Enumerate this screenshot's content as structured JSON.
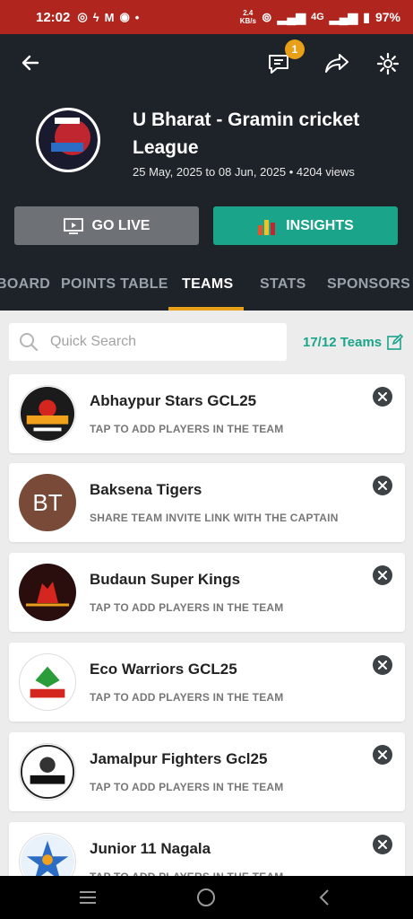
{
  "status": {
    "time": "12:02",
    "speed_top": "2.4",
    "speed_bottom": "KB/s",
    "network": "4G",
    "battery": "97%"
  },
  "header": {
    "back_icon": "back-arrow-icon",
    "message_badge": "1",
    "tournament_title": "U Bharat - Gramin cricket League",
    "dates": "25 May, 2025 to 08 Jun, 2025",
    "views": "4204 views",
    "go_live_label": "GO LIVE",
    "insights_label": "INSIGHTS"
  },
  "tabs": [
    "BOARD",
    "POINTS TABLE",
    "TEAMS",
    "STATS",
    "SPONSORS"
  ],
  "active_tab": "TEAMS",
  "search": {
    "placeholder": "Quick Search"
  },
  "teams_count": "17/12 Teams",
  "teams": [
    {
      "name": "Abhaypur Stars GCL25",
      "sub": "TAP TO ADD PLAYERS IN THE TEAM"
    },
    {
      "name": "Baksena Tigers",
      "sub": "SHARE TEAM INVITE LINK WITH THE CAPTAIN",
      "initials": "BT"
    },
    {
      "name": "Budaun Super Kings",
      "sub": "TAP TO ADD PLAYERS IN THE TEAM"
    },
    {
      "name": "Eco Warriors GCL25",
      "sub": "TAP TO ADD PLAYERS IN THE TEAM"
    },
    {
      "name": "Jamalpur Fighters Gcl25",
      "sub": "TAP TO ADD PLAYERS IN THE TEAM"
    },
    {
      "name": "Junior 11 Nagala",
      "sub": "TAP TO ADD PLAYERS IN THE TEAM"
    }
  ],
  "colors": {
    "accent": "#1aa58a",
    "header_bg": "#1d2329",
    "tab_indicator": "#e8a019",
    "status_bar": "#b0261f"
  }
}
